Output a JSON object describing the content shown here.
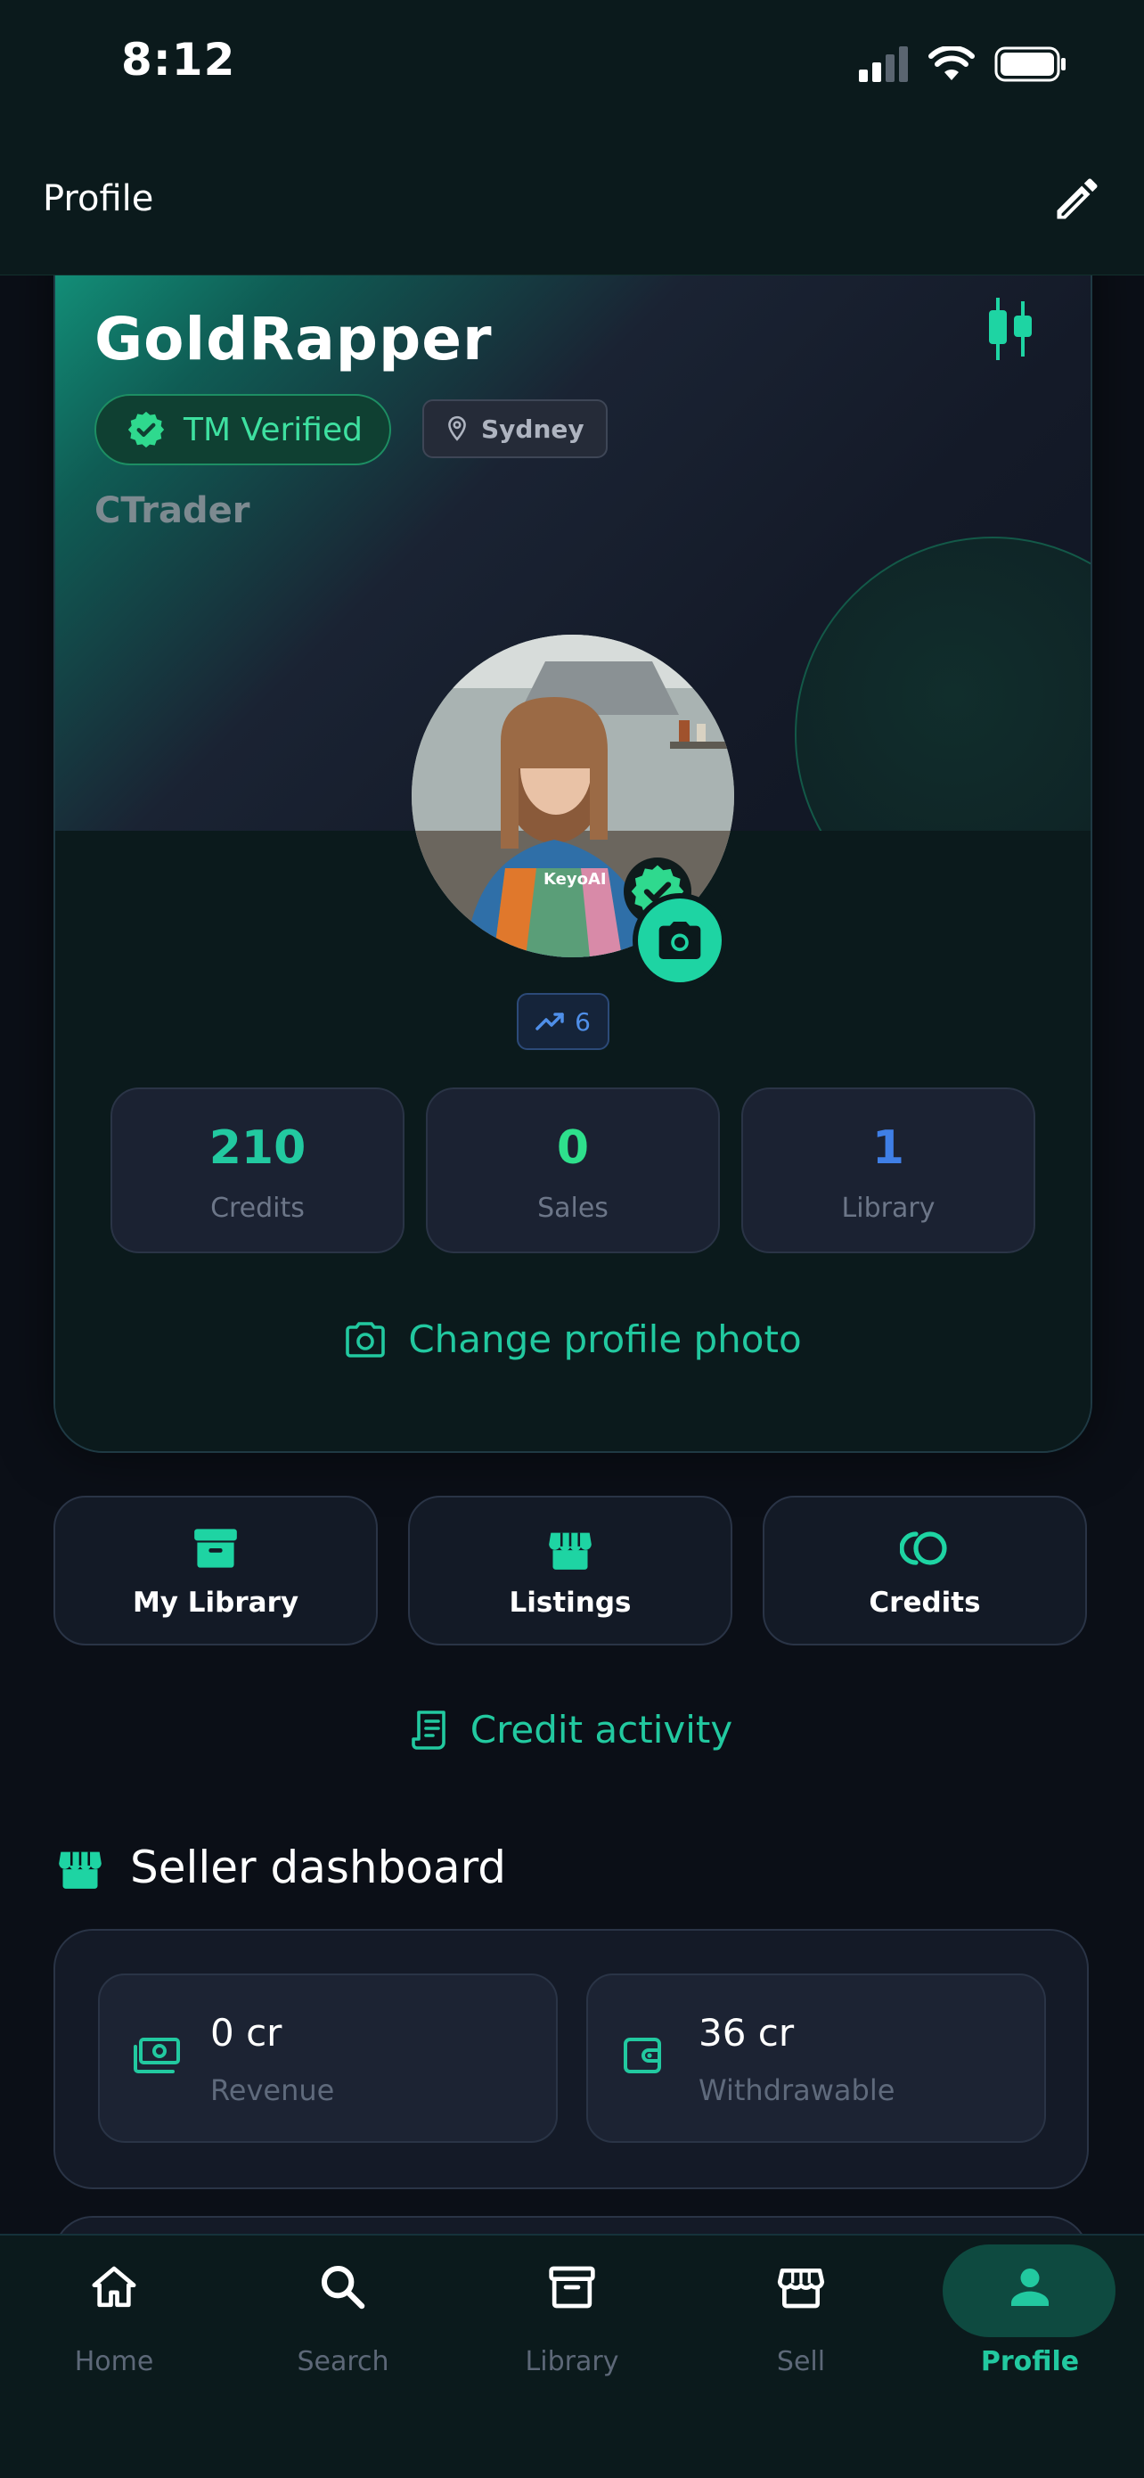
{
  "status_bar": {
    "time": "8:12"
  },
  "header": {
    "title": "Profile"
  },
  "profile": {
    "username": "GoldRapper",
    "verified_label": "TM Verified",
    "location": "Sydney",
    "role": "CTrader",
    "trend_count": "6",
    "avatar_apron_text": "KeyoAI",
    "stats": [
      {
        "value": "210",
        "label": "Credits",
        "color": "#22c9a0"
      },
      {
        "value": "0",
        "label": "Sales",
        "color": "#2ee08c"
      },
      {
        "value": "1",
        "label": "Library",
        "color": "#3f7fe6"
      }
    ],
    "change_photo_label": "Change profile photo"
  },
  "quick_actions": [
    {
      "label": "My Library",
      "icon": "archive-icon"
    },
    {
      "label": "Listings",
      "icon": "store-icon"
    },
    {
      "label": "Credits",
      "icon": "coins-icon"
    }
  ],
  "credit_activity_label": "Credit activity",
  "seller_dashboard": {
    "title": "Seller dashboard",
    "metrics": [
      {
        "value": "0 cr",
        "label": "Revenue",
        "icon": "cash-icon"
      },
      {
        "value": "36 cr",
        "label": "Withdrawable",
        "icon": "wallet-icon"
      }
    ]
  },
  "tabbar": {
    "items": [
      {
        "label": "Home",
        "icon": "home-icon"
      },
      {
        "label": "Search",
        "icon": "search-icon"
      },
      {
        "label": "Library",
        "icon": "archive-icon"
      },
      {
        "label": "Sell",
        "icon": "store-icon"
      },
      {
        "label": "Profile",
        "icon": "person-icon"
      }
    ],
    "active": "Profile"
  },
  "colors": {
    "accent": "#22c9a0",
    "background": "#0b0f17",
    "verified": "#3ee0a0",
    "blue": "#3f7fe6"
  }
}
